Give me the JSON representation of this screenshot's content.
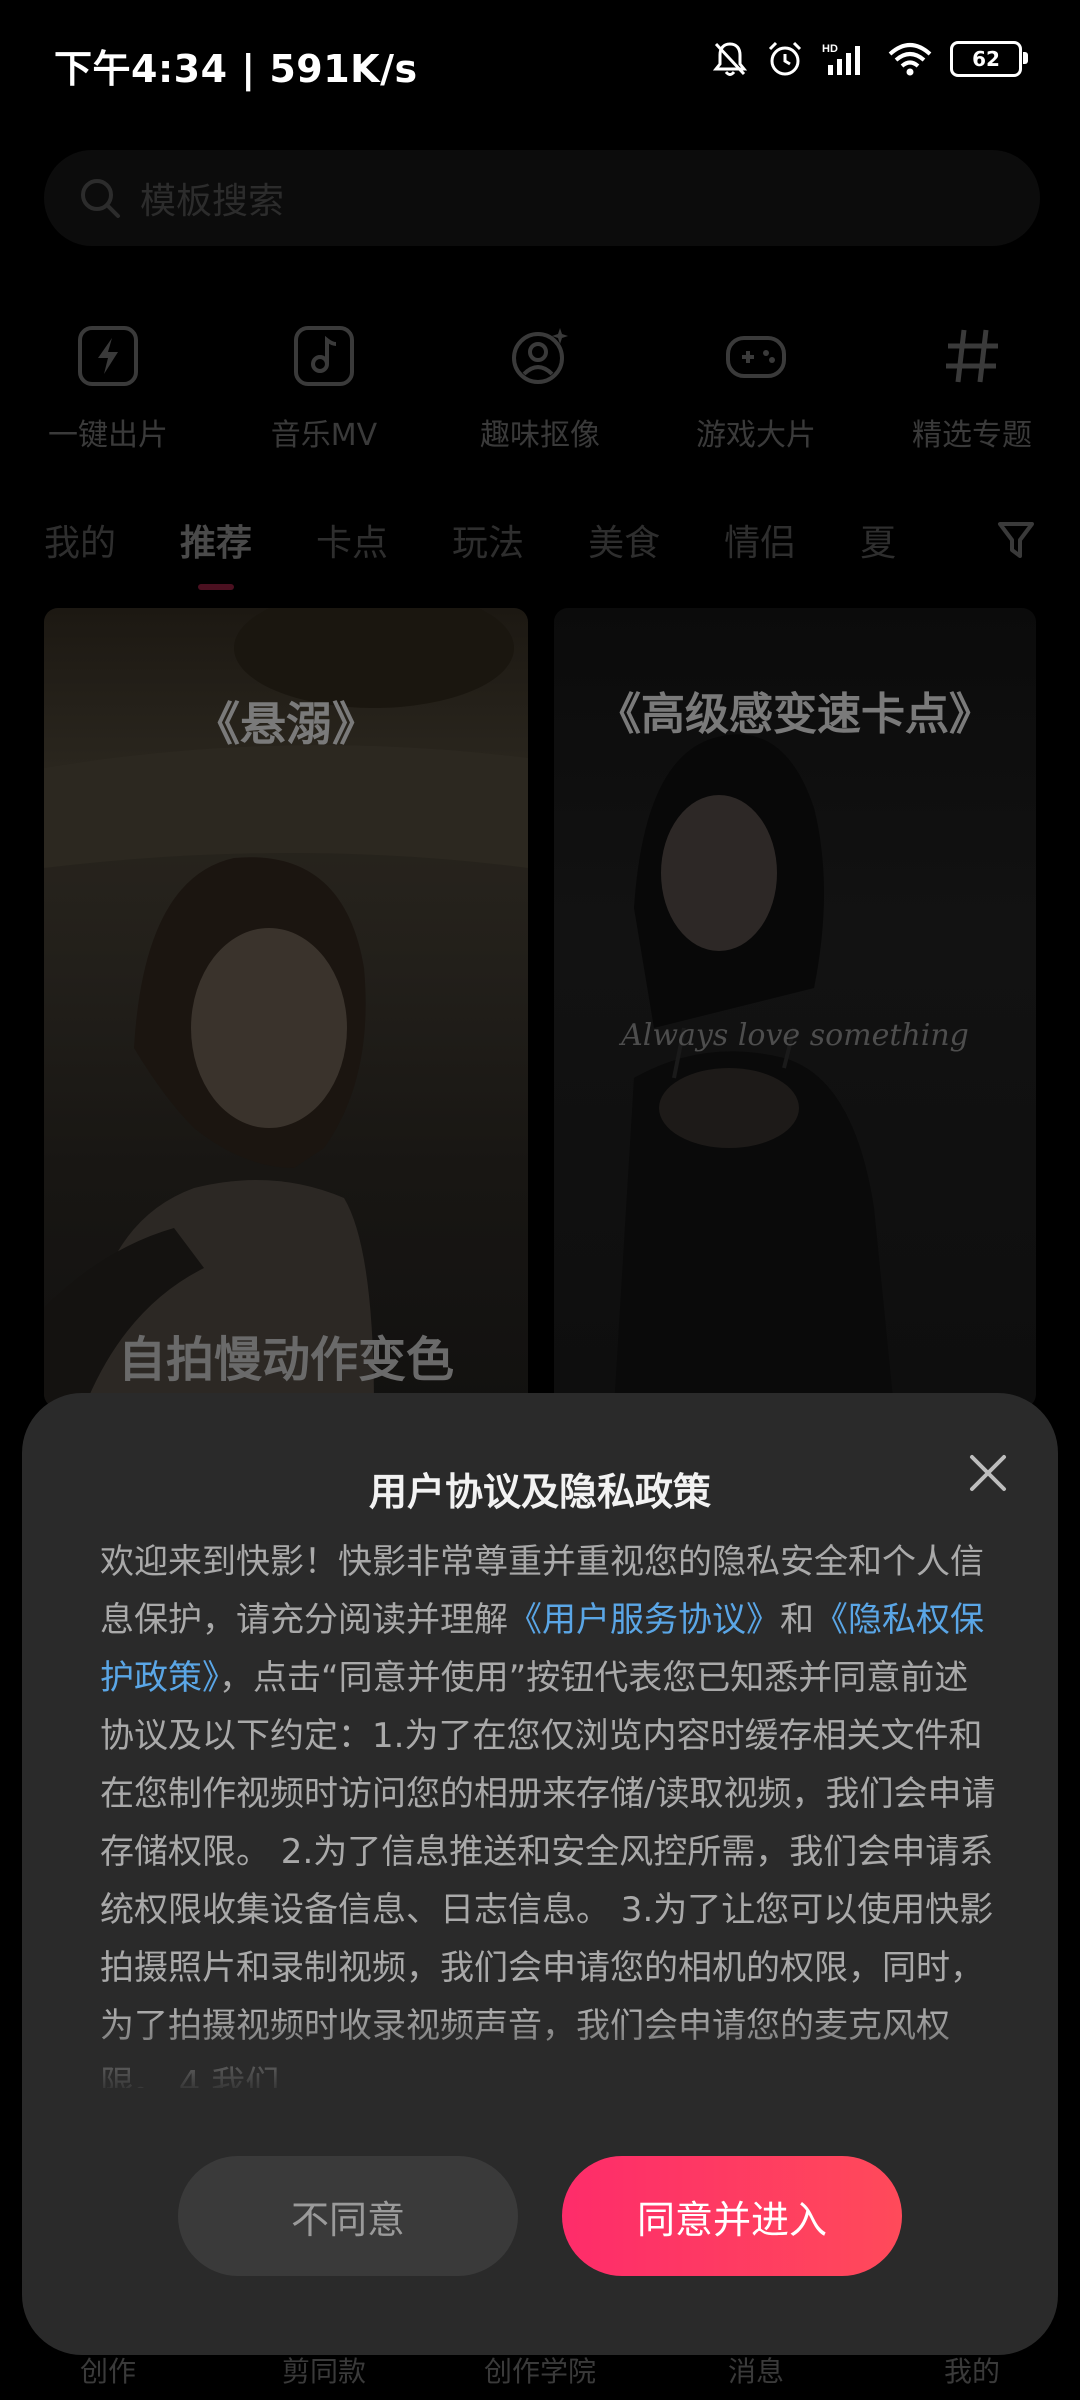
{
  "status_bar": {
    "time": "下午4:34 | 591K/s",
    "battery": "62"
  },
  "search": {
    "placeholder": "模板搜索"
  },
  "shortcuts": [
    {
      "label": "一键出片",
      "icon": "lightning-icon"
    },
    {
      "label": "音乐MV",
      "icon": "music-note-icon"
    },
    {
      "label": "趣味抠像",
      "icon": "portrait-sparkle-icon"
    },
    {
      "label": "游戏大片",
      "icon": "gamepad-icon"
    },
    {
      "label": "精选专题",
      "icon": "hashtag-icon"
    }
  ],
  "tabs": [
    "我的",
    "推荐",
    "卡点",
    "玩法",
    "美食",
    "情侣",
    "夏"
  ],
  "active_tab": "推荐",
  "cards": [
    {
      "title": "《悬溺》",
      "bottom_text": "自拍慢动作变色"
    },
    {
      "title": "《高级感变速卡点》",
      "caption": "Always love something"
    }
  ],
  "bottom_nav": [
    "创作",
    "剪同款",
    "创作学院",
    "消息",
    "我的"
  ],
  "dialog": {
    "title": "用户协议及隐私政策",
    "body_part1": "欢迎来到快影！快影非常尊重并重视您的隐私安全和个人信息保护，请充分阅读并理解",
    "link1": "《用户服务协议》",
    "body_and": "和",
    "link2": "《隐私权保护政策》",
    "body_part2": "，点击“同意并使用”按钮代表您已知悉并同意前述协议及以下约定：1.为了在您仅浏览内容时缓存相关文件和在您制作视频时访问您的相册来存储/读取视频，我们会申请存储权限。 2.为了信息推送和安全风控所需，我们会申请系统权限收集设备信息、日志信息。 3.为了让您可以使用快影拍摄照片和录制视频，我们会申请您的相机的权限，同时，为了拍摄视频时收录视频声音，我们会申请您的麦克风权限。 4.我们",
    "disagree_label": "不同意",
    "agree_label": "同意并进入"
  },
  "colors": {
    "accent": "#fe2c6a",
    "link": "#5aa6e6",
    "sheet_bg": "#2a2a2a"
  }
}
